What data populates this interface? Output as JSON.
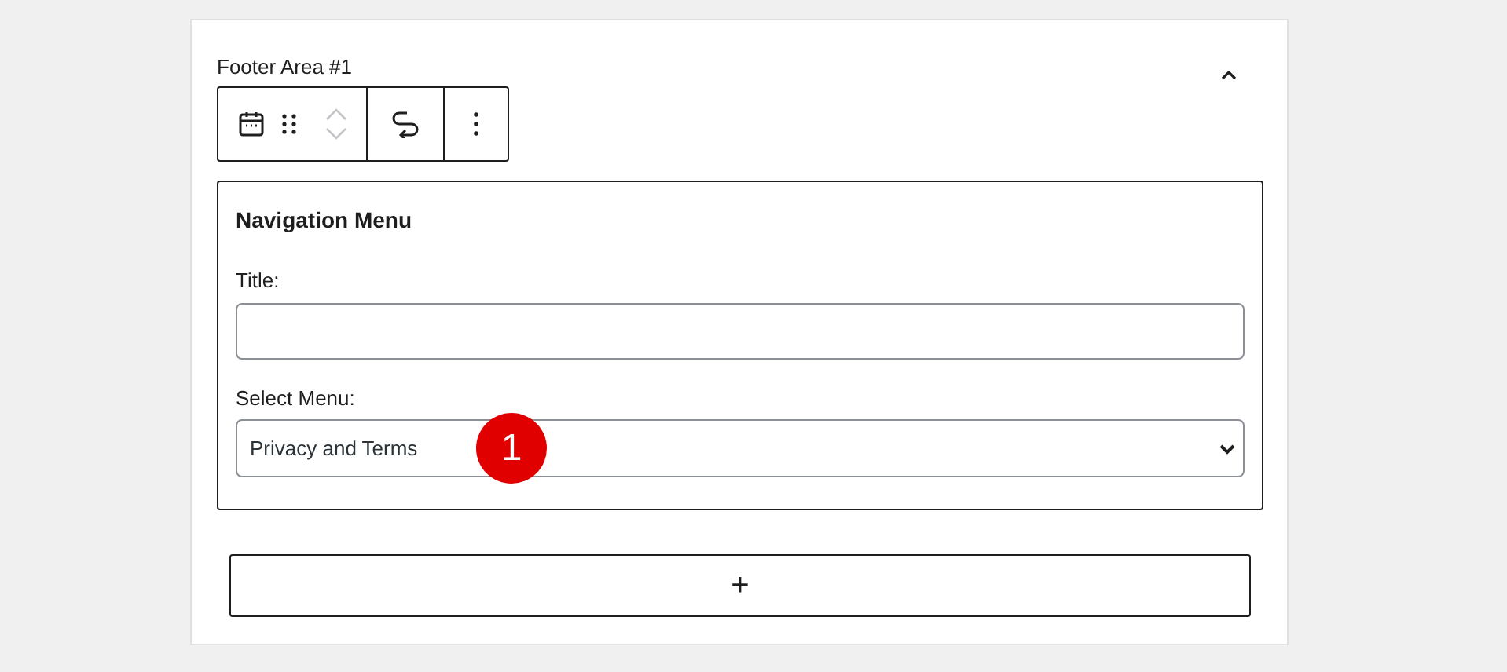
{
  "panel": {
    "title": "Footer Area #1",
    "expanded": true
  },
  "block": {
    "title": "Navigation Menu",
    "fields": [
      {
        "kind": "text",
        "label": "Title:"
      },
      {
        "kind": "select",
        "label": "Select Menu:",
        "value": "Privacy and Terms"
      }
    ]
  },
  "callout": {
    "text": "1"
  },
  "add_button": {
    "text": "+"
  }
}
